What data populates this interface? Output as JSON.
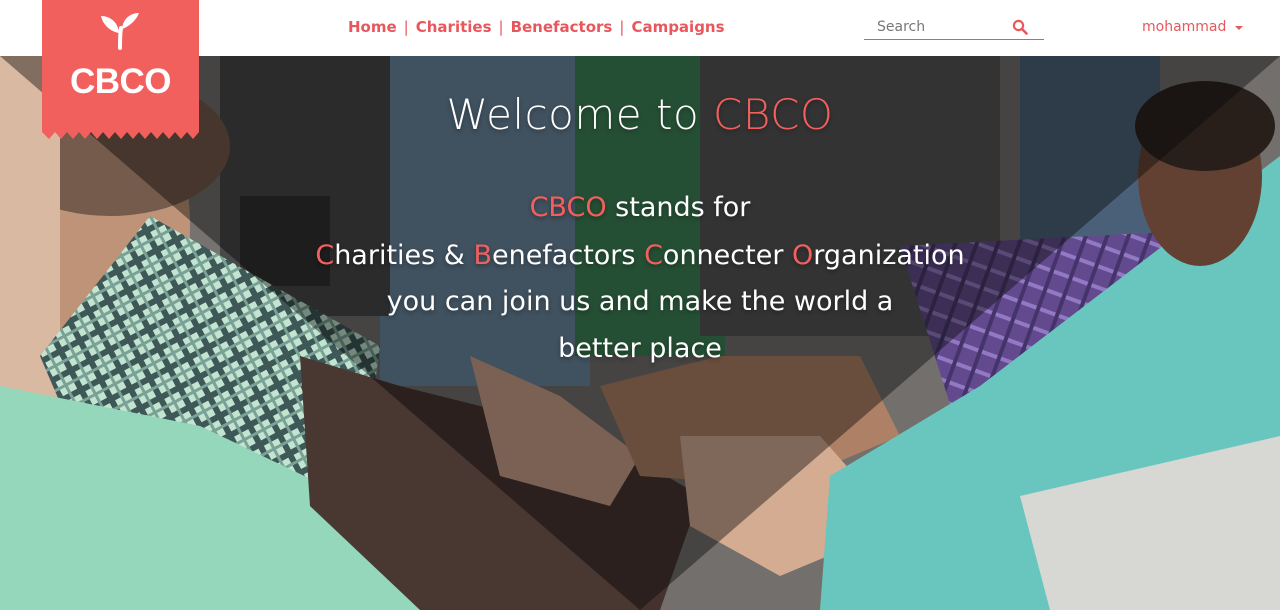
{
  "brand": {
    "logo_text": "CBCO",
    "logo_icon": "sprout-icon",
    "accent": "#f2605e",
    "ribbon_color": "#f2605e"
  },
  "nav": {
    "items": [
      {
        "label": "Home"
      },
      {
        "label": "Charities"
      },
      {
        "label": "Benefactors"
      },
      {
        "label": "Campaigns"
      }
    ],
    "separator": "|"
  },
  "search": {
    "placeholder": "Search",
    "value": "",
    "icon": "search-icon"
  },
  "user": {
    "name": "mohammad",
    "icon": "caret-down-icon"
  },
  "hero": {
    "title_prefix": "Welcome to ",
    "title_brand": "CBCO",
    "line1_brand": "CBCO",
    "line1_rest": " stands for",
    "line2": [
      {
        "initial": "C",
        "rest": "harities & "
      },
      {
        "initial": "B",
        "rest": "enefactors "
      },
      {
        "initial": "C",
        "rest": "onnecter "
      },
      {
        "initial": "O",
        "rest": "rganization"
      }
    ],
    "line3": "you can join us and make the world a",
    "line4": "better place"
  }
}
